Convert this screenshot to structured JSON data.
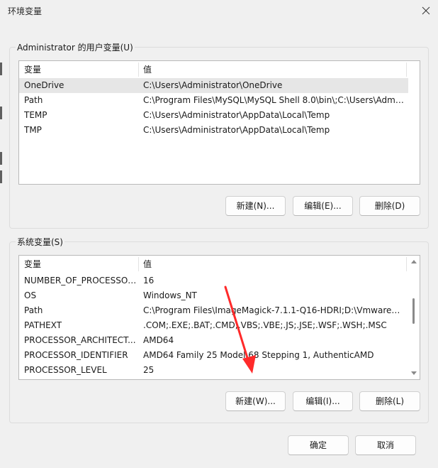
{
  "window": {
    "title": "环境变量",
    "close_icon": "close-icon"
  },
  "user_vars": {
    "group_label": "Administrator 的用户变量(U)",
    "columns": {
      "name": "变量",
      "value": "值"
    },
    "rows": [
      {
        "name": "OneDrive",
        "value": "C:\\Users\\Administrator\\OneDrive"
      },
      {
        "name": "Path",
        "value": "C:\\Program Files\\MySQL\\MySQL Shell 8.0\\bin\\;C:\\Users\\Admi..."
      },
      {
        "name": "TEMP",
        "value": "C:\\Users\\Administrator\\AppData\\Local\\Temp"
      },
      {
        "name": "TMP",
        "value": "C:\\Users\\Administrator\\AppData\\Local\\Temp"
      }
    ],
    "selected_row": 0,
    "buttons": {
      "new": "新建(N)...",
      "edit": "编辑(E)...",
      "delete": "删除(D)"
    }
  },
  "system_vars": {
    "group_label": "系统变量(S)",
    "columns": {
      "name": "变量",
      "value": "值"
    },
    "rows": [
      {
        "name": "NUMBER_OF_PROCESSORS",
        "value": "16"
      },
      {
        "name": "OS",
        "value": "Windows_NT"
      },
      {
        "name": "Path",
        "value": "C:\\Program Files\\ImageMagick-7.1.1-Q16-HDRI;D:\\Vmware1..."
      },
      {
        "name": "PATHEXT",
        "value": ".COM;.EXE;.BAT;.CMD;.VBS;.VBE;.JS;.JSE;.WSF;.WSH;.MSC"
      },
      {
        "name": "PROCESSOR_ARCHITECT...",
        "value": "AMD64"
      },
      {
        "name": "PROCESSOR_IDENTIFIER",
        "value": "AMD64 Family 25 Model 68 Stepping 1, AuthenticAMD"
      },
      {
        "name": "PROCESSOR_LEVEL",
        "value": "25"
      }
    ],
    "buttons": {
      "new": "新建(W)...",
      "edit": "编辑(I)...",
      "delete": "删除(L)"
    }
  },
  "footer": {
    "ok": "确定",
    "cancel": "取消"
  },
  "annotation": {
    "color": "#ff2a2a"
  }
}
